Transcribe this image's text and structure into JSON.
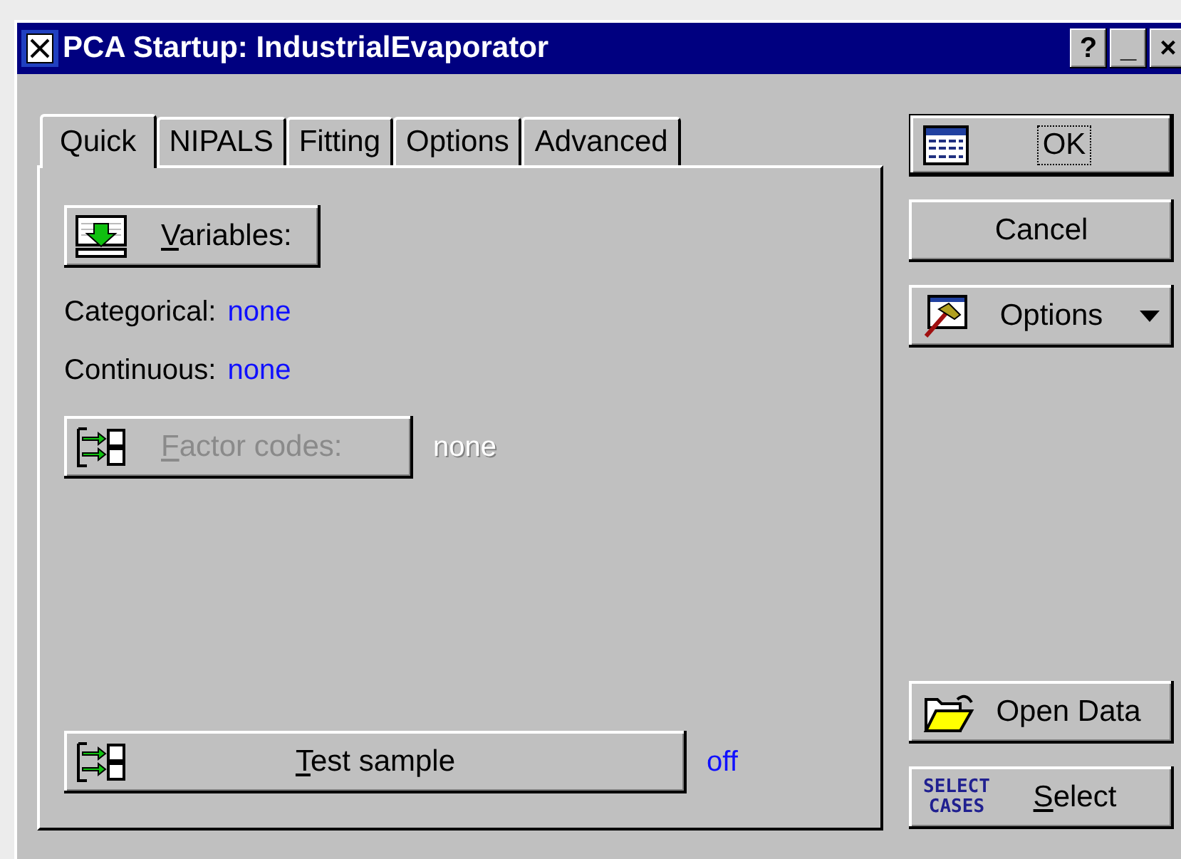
{
  "window": {
    "title": "PCA Startup: IndustrialEvaporator",
    "title_buttons": [
      "?",
      "_",
      "×"
    ]
  },
  "tabs": [
    {
      "label": "Quick",
      "selected": true
    },
    {
      "label": "NIPALS",
      "selected": false
    },
    {
      "label": "Fitting",
      "selected": false
    },
    {
      "label": "Options",
      "selected": false
    },
    {
      "label": "Advanced",
      "selected": false
    }
  ],
  "variables_button": {
    "label": "Variables:",
    "mnemonic": true,
    "disabled": false
  },
  "variable_rows": [
    {
      "label": "Categorical:",
      "value": "none"
    },
    {
      "label": "Continuous:",
      "value": "none"
    }
  ],
  "factor_codes": {
    "label": "Factor codes:",
    "mnemonic": true,
    "disabled": true,
    "value": "none"
  },
  "test_sample": {
    "label": "Test sample",
    "mnemonic": true,
    "disabled": false,
    "value": "off"
  },
  "side_buttons": [
    {
      "label": "OK",
      "kind": "table",
      "default": true,
      "focused": true,
      "dropdown": false,
      "mnemonic": false
    },
    {
      "label": "Cancel",
      "kind": "plain",
      "default": false,
      "focused": false,
      "dropdown": false,
      "mnemonic": false
    },
    {
      "label": "Options",
      "kind": "hammer",
      "default": false,
      "focused": false,
      "dropdown": true,
      "mnemonic": false
    }
  ],
  "side_buttons_bottom": [
    {
      "label": "Open Data",
      "kind": "folder",
      "mnemonic": false
    },
    {
      "label": "Select",
      "kind": "select-cases",
      "icon_lines": [
        "SELECT",
        "CASES"
      ],
      "mnemonic": true
    }
  ]
}
